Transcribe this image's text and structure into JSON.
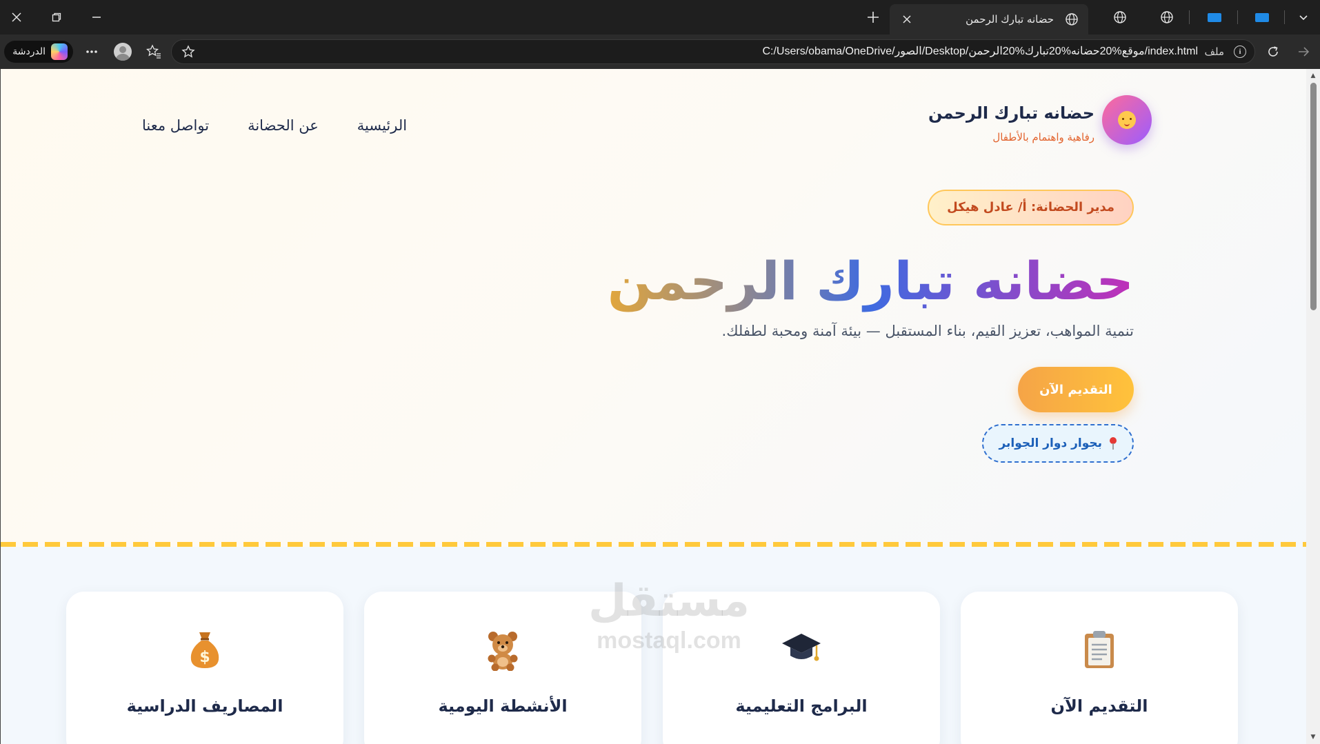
{
  "browser": {
    "tab_title": "حضانه تبارك الرحمن",
    "address_scheme": "ملف",
    "address_url": "C:/Users/obama/OneDrive/الصور/Desktop/موقع%20حضانه%20تبارك%20الرحمن/index.html",
    "copilot_label": "الدردشة"
  },
  "nav": {
    "brand_name": "حضانه تبارك الرحمن",
    "brand_tagline": "رفاهية واهتمام بالأطفال",
    "links": [
      "الرئيسية",
      "عن الحضانة",
      "تواصل معنا"
    ]
  },
  "hero": {
    "director": "مدير الحضانة: أ/ عادل هيكل",
    "title": "حضانه تبارك الرحمن",
    "subtitle": "تنمية المواهب، تعزيز القيم، بناء المستقبل — بيئة آمنة ومحبة لطفلك.",
    "cta_label": "التقديم الآن",
    "location_label": "بجوار دوار الجوابر"
  },
  "cards": [
    {
      "title": "التقديم الآن",
      "icon": "clipboard-icon"
    },
    {
      "title": "البرامج التعليمية",
      "icon": "graduation-cap-icon"
    },
    {
      "title": "الأنشطة اليومية",
      "icon": "teddy-bear-icon"
    },
    {
      "title": "المصاريف الدراسية",
      "icon": "money-bag-icon"
    }
  ],
  "watermark": {
    "arabic": "مستقل",
    "latin": "mostaql.com"
  },
  "colors": {
    "accent_orange": "#f5a447",
    "navy": "#1e2a4a",
    "tagline_orange": "#e2632d",
    "location_blue": "#2f6fcf",
    "divider_yellow": "#ffc93c"
  }
}
